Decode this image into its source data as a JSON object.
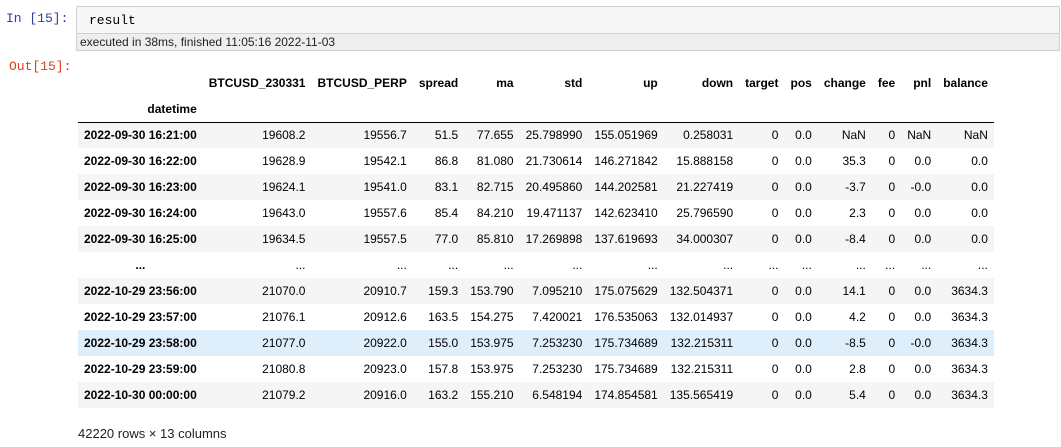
{
  "input": {
    "prompt": "In  [15]:",
    "code": "result",
    "exec_info": "executed in 38ms, finished 11:05:16 2022-11-03"
  },
  "output": {
    "prompt": "Out[15]:",
    "columns": [
      "BTCUSD_230331",
      "BTCUSD_PERP",
      "spread",
      "ma",
      "std",
      "up",
      "down",
      "target",
      "pos",
      "change",
      "fee",
      "pnl",
      "balance"
    ],
    "index_name": "datetime",
    "rows": [
      {
        "index": "2022-09-30 16:21:00",
        "cells": [
          "19608.2",
          "19556.7",
          "51.5",
          "77.655",
          "25.798990",
          "155.051969",
          "0.258031",
          "0",
          "0.0",
          "NaN",
          "0",
          "NaN",
          "NaN"
        ]
      },
      {
        "index": "2022-09-30 16:22:00",
        "cells": [
          "19628.9",
          "19542.1",
          "86.8",
          "81.080",
          "21.730614",
          "146.271842",
          "15.888158",
          "0",
          "0.0",
          "35.3",
          "0",
          "0.0",
          "0.0"
        ]
      },
      {
        "index": "2022-09-30 16:23:00",
        "cells": [
          "19624.1",
          "19541.0",
          "83.1",
          "82.715",
          "20.495860",
          "144.202581",
          "21.227419",
          "0",
          "0.0",
          "-3.7",
          "0",
          "-0.0",
          "0.0"
        ]
      },
      {
        "index": "2022-09-30 16:24:00",
        "cells": [
          "19643.0",
          "19557.6",
          "85.4",
          "84.210",
          "19.471137",
          "142.623410",
          "25.796590",
          "0",
          "0.0",
          "2.3",
          "0",
          "0.0",
          "0.0"
        ]
      },
      {
        "index": "2022-09-30 16:25:00",
        "cells": [
          "19634.5",
          "19557.5",
          "77.0",
          "85.810",
          "17.269898",
          "137.619693",
          "34.000307",
          "0",
          "0.0",
          "-8.4",
          "0",
          "0.0",
          "0.0"
        ]
      },
      {
        "index": "...",
        "cells": [
          "...",
          "...",
          "...",
          "...",
          "...",
          "...",
          "...",
          "...",
          "...",
          "...",
          "...",
          "...",
          "..."
        ],
        "ellipsis": true
      },
      {
        "index": "2022-10-29 23:56:00",
        "cells": [
          "21070.0",
          "20910.7",
          "159.3",
          "153.790",
          "7.095210",
          "175.075629",
          "132.504371",
          "0",
          "0.0",
          "14.1",
          "0",
          "0.0",
          "3634.3"
        ]
      },
      {
        "index": "2022-10-29 23:57:00",
        "cells": [
          "21076.1",
          "20912.6",
          "163.5",
          "154.275",
          "7.420021",
          "176.535063",
          "132.014937",
          "0",
          "0.0",
          "4.2",
          "0",
          "0.0",
          "3634.3"
        ]
      },
      {
        "index": "2022-10-29 23:58:00",
        "cells": [
          "21077.0",
          "20922.0",
          "155.0",
          "153.975",
          "7.253230",
          "175.734689",
          "132.215311",
          "0",
          "0.0",
          "-8.5",
          "0",
          "-0.0",
          "3634.3"
        ],
        "highlighted": true
      },
      {
        "index": "2022-10-29 23:59:00",
        "cells": [
          "21080.8",
          "20923.0",
          "157.8",
          "153.975",
          "7.253230",
          "175.734689",
          "132.215311",
          "0",
          "0.0",
          "2.8",
          "0",
          "0.0",
          "3634.3"
        ]
      },
      {
        "index": "2022-10-30 00:00:00",
        "cells": [
          "21079.2",
          "20916.0",
          "163.2",
          "155.210",
          "6.548194",
          "174.854581",
          "135.565419",
          "0",
          "0.0",
          "5.4",
          "0",
          "0.0",
          "3634.3"
        ]
      }
    ],
    "shape_text": "42220 rows × 13 columns"
  }
}
